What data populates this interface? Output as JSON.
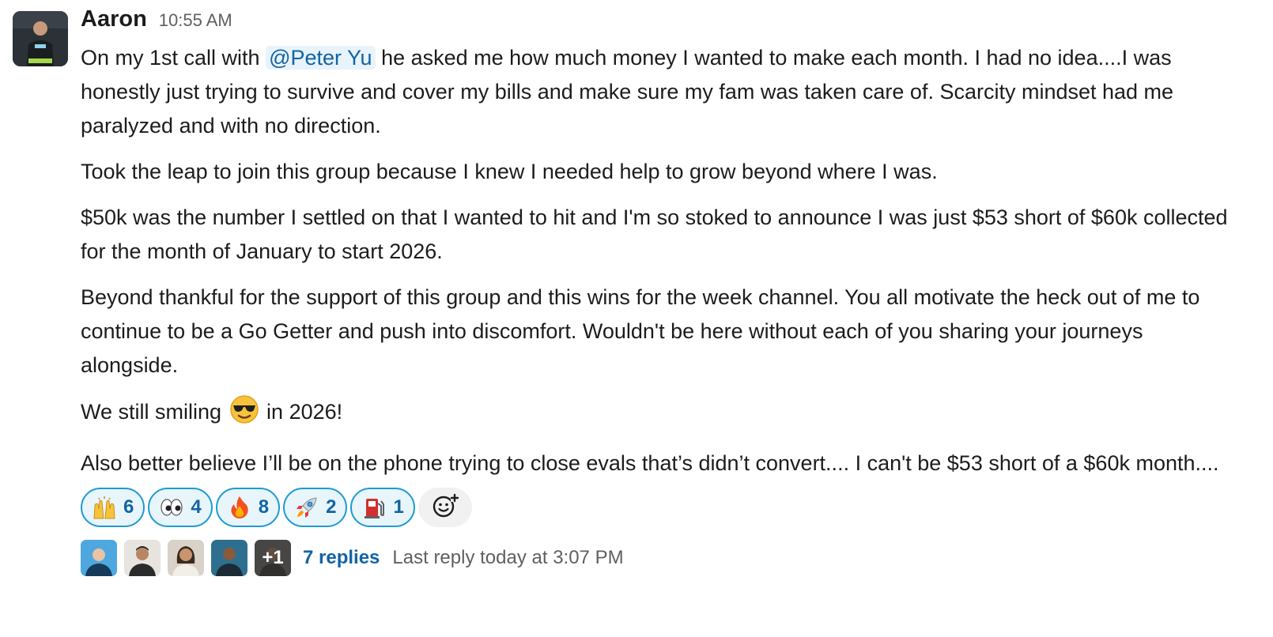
{
  "message": {
    "author": "Aaron",
    "time": "10:55 AM",
    "p1_before": "On my 1st call with ",
    "mention": "@Peter Yu",
    "p1_after": " he asked me how much money I wanted to make each month. I had no idea....I was honestly just trying to survive and cover my bills and make sure my fam was taken care of. Scarcity mindset had me paralyzed and with no direction.",
    "p2": "Took the leap to join this group because I knew I needed help to grow beyond where I was.",
    "p3": "$50k was the number I settled on that I wanted to hit and I'm so stoked to announce I was just $53 short of $60k collected for the month of January to start 2026.",
    "p4": "Beyond thankful for the support of this group and this wins for the week channel. You all motivate the heck out of me to continue to be a Go Getter and push into discomfort. Wouldn't be here without each of you sharing your journeys alongside.",
    "p5_before": "We still smiling ",
    "p5_after": " in 2026!",
    "p6": "Also better believe I’ll be on the phone trying to close evals that’s didn’t convert.... I can't be $53 short of a $60k month...."
  },
  "reactions": [
    {
      "icon": "raised-hands-icon",
      "count": "6"
    },
    {
      "icon": "eyes-icon",
      "count": "4"
    },
    {
      "icon": "fire-icon",
      "count": "8"
    },
    {
      "icon": "rocket-icon",
      "count": "2"
    },
    {
      "icon": "fuel-pump-icon",
      "count": "1"
    }
  ],
  "thread": {
    "extra_count": "+1",
    "replies": "7 replies",
    "last_reply": "Last reply today at 3:07 PM"
  },
  "colors": {
    "link": "#1264a3",
    "reaction_border": "#1d9bd1",
    "reaction_bg": "#e8f5fa",
    "muted": "#616061"
  }
}
